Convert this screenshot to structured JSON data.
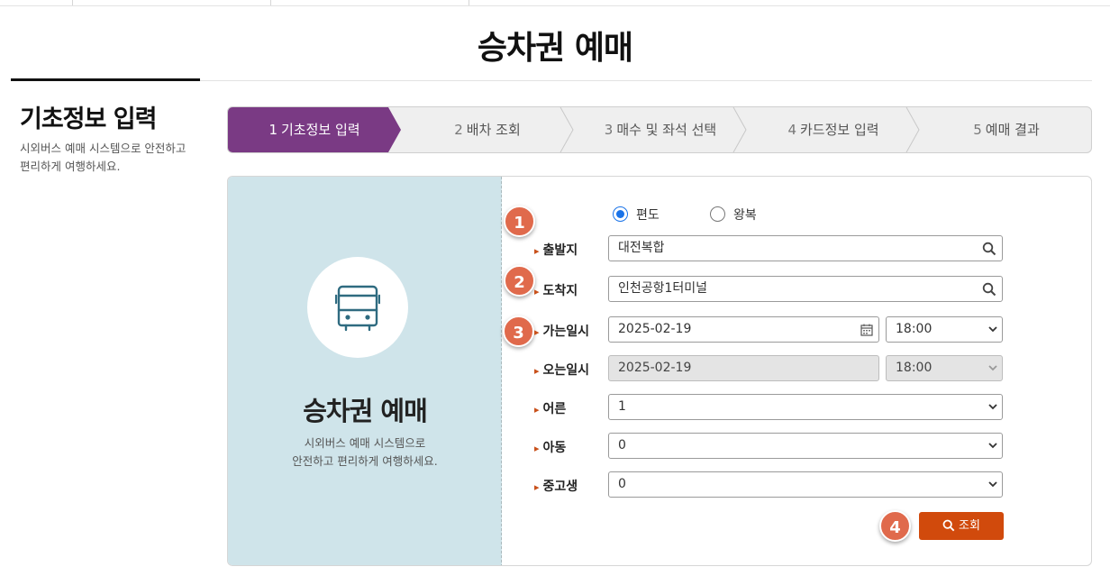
{
  "page": {
    "title": "승차권 예매"
  },
  "sidebar": {
    "title": "기초정보 입력",
    "description": "시외버스 예매 시스템으로 안전하고 편리하게 여행하세요."
  },
  "steps": [
    {
      "num": "1",
      "label": "기초정보 입력",
      "active": true
    },
    {
      "num": "2",
      "label": "배차 조회",
      "active": false
    },
    {
      "num": "3",
      "label": "매수 및 좌석 선택",
      "active": false
    },
    {
      "num": "4",
      "label": "카드정보 입력",
      "active": false
    },
    {
      "num": "5",
      "label": "예매 결과",
      "active": false
    }
  ],
  "left_panel": {
    "icon": "bus-icon",
    "title": "승차권 예매",
    "desc_line1": "시외버스 예매 시스템으로",
    "desc_line2": "안전하고 편리하게 여행하세요."
  },
  "trip_type": {
    "options": [
      "편도",
      "왕복"
    ],
    "selected": "편도"
  },
  "form": {
    "departure": {
      "label": "출발지",
      "value": "대전복합"
    },
    "arrival": {
      "label": "도착지",
      "value": "인천공항1터미널"
    },
    "go_date": {
      "label": "가는일시",
      "date": "2025-02-19",
      "time": "18:00"
    },
    "return_date": {
      "label": "오는일시",
      "date": "2025-02-19",
      "time": "18:00",
      "disabled": true
    },
    "adult": {
      "label": "어른",
      "value": "1"
    },
    "child": {
      "label": "아동",
      "value": "0"
    },
    "student": {
      "label": "중고생",
      "value": "0"
    }
  },
  "badges": [
    "1",
    "2",
    "3",
    "4"
  ],
  "search_button": {
    "label": "조회"
  },
  "colors": {
    "accent_purple": "#7a3a84",
    "button_orange": "#d14a0c",
    "badge": "#e06a4c",
    "panel_blue": "#cfe4ea",
    "bus_icon": "#2f6b80"
  }
}
